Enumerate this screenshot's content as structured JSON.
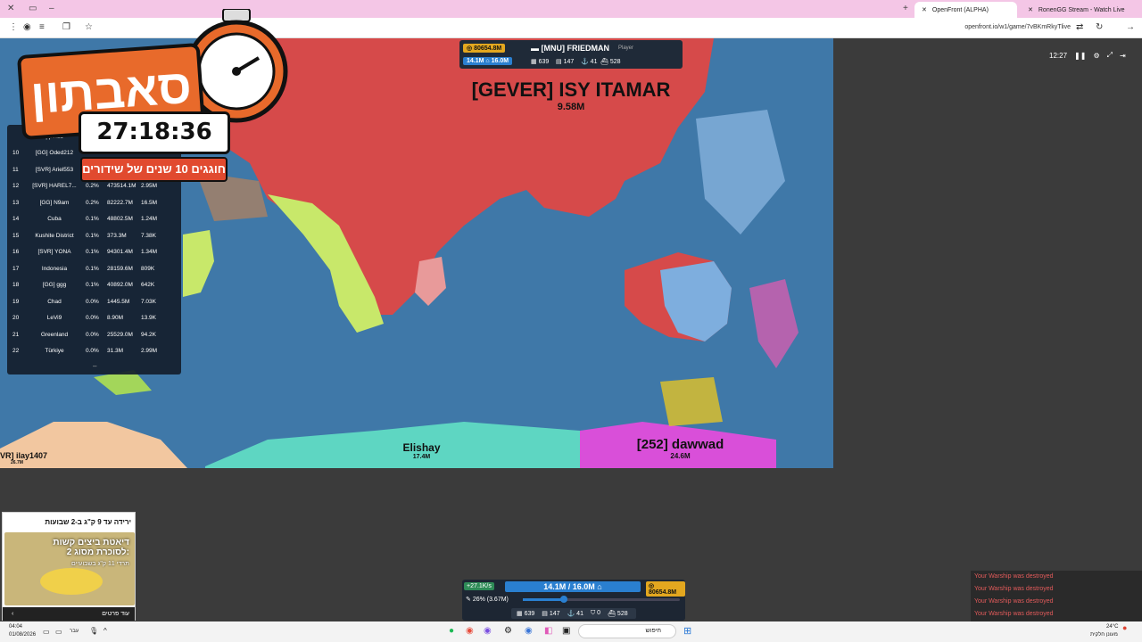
{
  "browser": {
    "tabs": [
      {
        "title": "OpenFront (ALPHA)",
        "active": true
      },
      {
        "title": "RonenGG Stream - Watch Live",
        "active": false
      }
    ],
    "url": "openfront.io/w1/game/7vBKmRkyTlive"
  },
  "player_bar": {
    "gold": "80654.8M",
    "player_name": "[MNU] FRIEDMAN",
    "player_tag": "Player",
    "troops": "14.1M",
    "max_troops": "16.0M",
    "stat1": "639",
    "stat2": "147",
    "stat3": "41",
    "stat4": "528"
  },
  "game_controls": {
    "time": "12:27"
  },
  "map_labels": [
    {
      "name": "[GEVER] ISY ITAMAR",
      "value": "9.58M"
    },
    {
      "name": "Elishay",
      "value": "17.4M"
    },
    {
      "name": "[252] dawwad",
      "value": "24.6M"
    },
    {
      "name": "VR] ilay1407",
      "value": "26.7M"
    }
  ],
  "leaderboard": {
    "rows": [
      {
        "rank": "",
        "name": "ppines",
        "pct": "",
        "gold": "",
        "troops": ""
      },
      {
        "rank": "10",
        "name": "[GG] Oded212",
        "pct": "",
        "gold": "",
        "troops": ""
      },
      {
        "rank": "11",
        "name": "[SVR] Ariel553",
        "pct": "",
        "gold": "",
        "troops": ""
      },
      {
        "rank": "12",
        "name": "[SVR] HAREL7...",
        "pct": "0.2%",
        "gold": "473514.1M",
        "troops": "2.95M"
      },
      {
        "rank": "13",
        "name": "[GG] N9am",
        "pct": "0.2%",
        "gold": "82222.7M",
        "troops": "16.5M"
      },
      {
        "rank": "14",
        "name": "Cuba",
        "pct": "0.1%",
        "gold": "48802.5M",
        "troops": "1.24M"
      },
      {
        "rank": "15",
        "name": "Kushite District",
        "pct": "0.1%",
        "gold": "373.3M",
        "troops": "7.38K"
      },
      {
        "rank": "16",
        "name": "[SVR] YONA",
        "pct": "0.1%",
        "gold": "94301.4M",
        "troops": "1.34M"
      },
      {
        "rank": "17",
        "name": "Indonesia",
        "pct": "0.1%",
        "gold": "28159.6M",
        "troops": "809K"
      },
      {
        "rank": "18",
        "name": "[GG] ggg",
        "pct": "0.1%",
        "gold": "40892.0M",
        "troops": "642K"
      },
      {
        "rank": "19",
        "name": "Chad",
        "pct": "0.0%",
        "gold": "1445.5M",
        "troops": "7.03K"
      },
      {
        "rank": "20",
        "name": "LeVi9",
        "pct": "0.0%",
        "gold": "8.90M",
        "troops": "13.9K"
      },
      {
        "rank": "21",
        "name": "Greenland",
        "pct": "0.0%",
        "gold": "25529.0M",
        "troops": "94.2K"
      },
      {
        "rank": "22",
        "name": "Türkiye",
        "pct": "0.0%",
        "gold": "31.3M",
        "troops": "2.99M"
      }
    ]
  },
  "stream_overlay": {
    "title": "סאבתון",
    "timer": "27:18:36",
    "subtitle": "חוגגים 10 שנים של שידורים"
  },
  "ad": {
    "top": "ירידה עד 9 ק\"ג ב-2 שבועות",
    "headline": "דיאטת ביצים קשות לסוכרת מסוג 2:",
    "sub": "תרדי 11 ק\"ג בשבועיים",
    "footer": "עוד פרטים"
  },
  "bottom_bar": {
    "rate": "+27.1K/s",
    "troops_display": "14.1M / 16.0M",
    "gold": "80654.8M",
    "attack_ratio": "26% (3.67M)",
    "slider_value": 0.26,
    "stat1": "639",
    "stat2": "147",
    "stat3": "41",
    "stat4": "0",
    "stat5": "528"
  },
  "notifications": [
    "Your Warship was destroyed",
    "Your Warship was destroyed",
    "Your Warship was destroyed",
    "Your Warship was destroyed"
  ],
  "taskbar": {
    "time": "04:04",
    "date": "01/08/2026",
    "search": "חיפוש",
    "weather_temp": "24°C",
    "weather_text": "מעונן חלקית",
    "lang": "עבר"
  },
  "colors": {
    "ocean": "#3f78a8",
    "red_empire": "#d64a4a",
    "green_land": "#c8e86a",
    "teal": "#5ed6c2",
    "magenta": "#d94fd9",
    "notification": "#e05a5a"
  }
}
